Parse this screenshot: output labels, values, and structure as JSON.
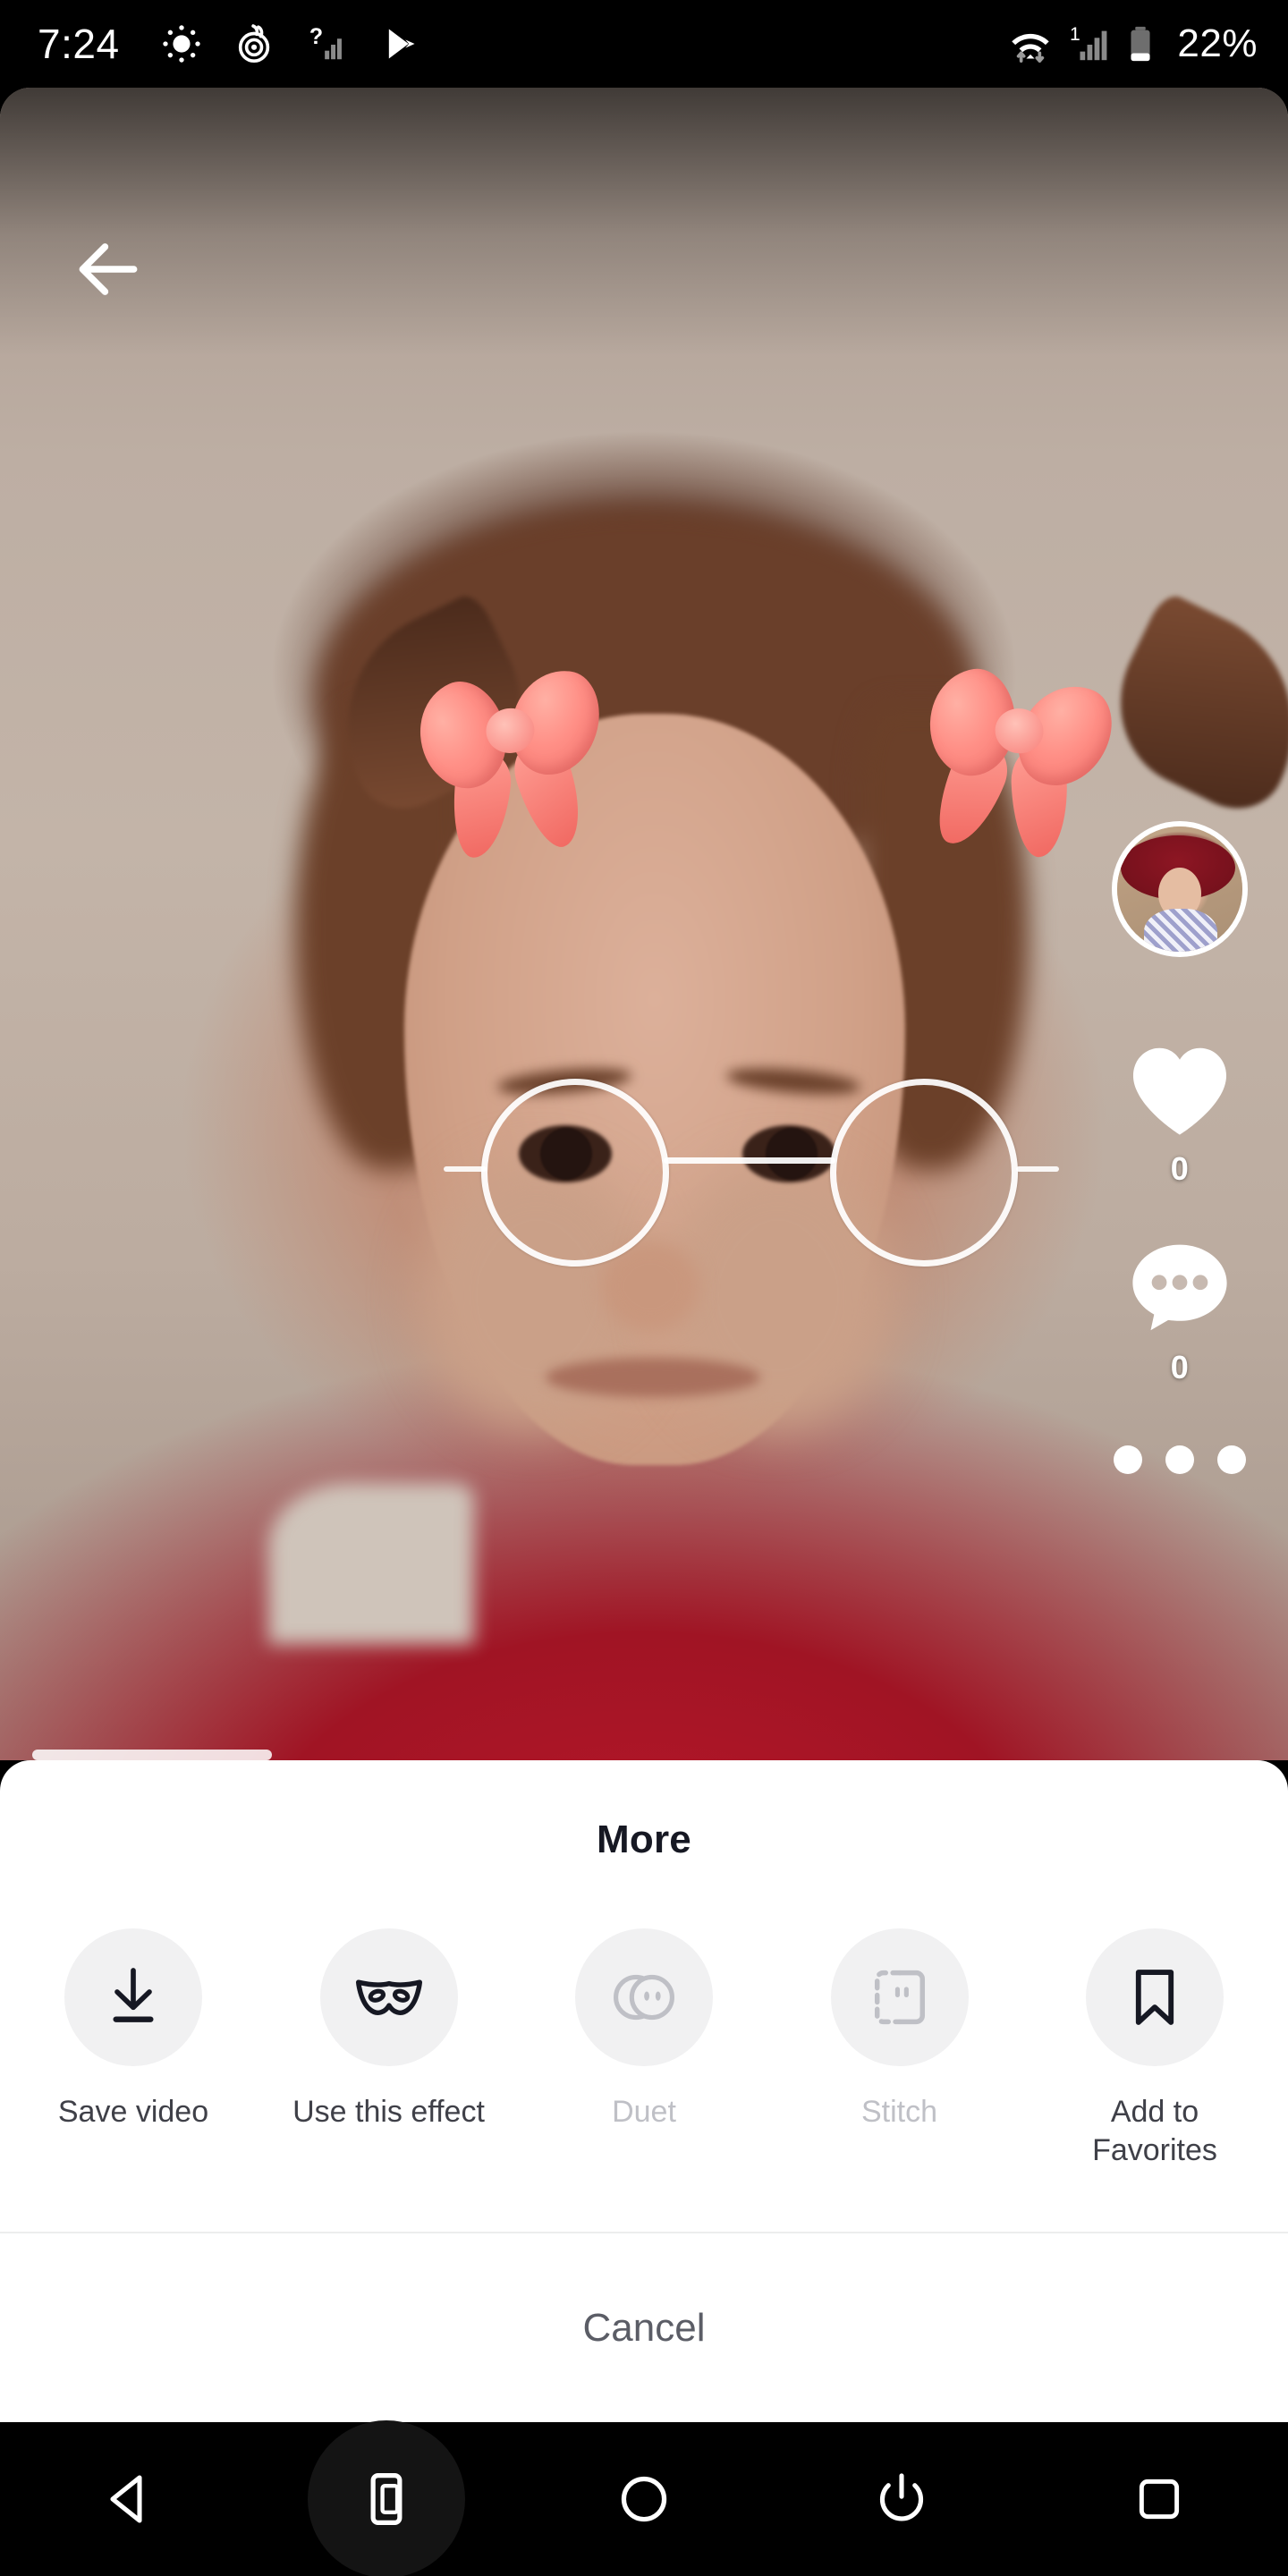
{
  "status_bar": {
    "time": "7:24",
    "battery_percent": "22%",
    "signal_label": "1",
    "icons": [
      "brightness-icon",
      "swirl-icon",
      "no-sim-signal-icon",
      "play-store-icon",
      "wifi-icon",
      "cellular-signal-icon",
      "battery-icon"
    ]
  },
  "video": {
    "back_icon": "back-arrow-icon",
    "description": "TikTok video with AR effect: woman with pink bows, round glasses and red turtleneck"
  },
  "action_rail": {
    "avatar_name": "creator-avatar",
    "like": {
      "icon": "heart-icon",
      "count": "0"
    },
    "comment": {
      "icon": "comment-bubble-icon",
      "count": "0"
    },
    "share": {
      "icon": "three-dots-icon"
    }
  },
  "sheet": {
    "title": "More",
    "actions": [
      {
        "label": "Save video",
        "icon": "download-icon",
        "disabled": false
      },
      {
        "label": "Use this effect",
        "icon": "mask-icon",
        "disabled": false
      },
      {
        "label": "Duet",
        "icon": "duet-icon",
        "disabled": true
      },
      {
        "label": "Stitch",
        "icon": "stitch-icon",
        "disabled": true
      },
      {
        "label": "Add to Favorites",
        "icon": "bookmark-icon",
        "disabled": false
      }
    ],
    "cancel_label": "Cancel"
  },
  "nav_bar": {
    "buttons": [
      {
        "name": "back-button",
        "icon": "triangle-back-icon"
      },
      {
        "name": "screenshot-button",
        "icon": "device-screenshot-icon"
      },
      {
        "name": "home-button",
        "icon": "circle-home-icon"
      },
      {
        "name": "power-button",
        "icon": "power-icon"
      },
      {
        "name": "recents-button",
        "icon": "square-recents-icon"
      }
    ]
  },
  "colors": {
    "sheet_bg": "#ffffff",
    "title_text": "#161823",
    "label_text": "#3f4048",
    "disabled_text": "#bfc0c6",
    "icon_bg": "#f1f1f2",
    "cancel_text": "#5b5d66",
    "nav_bg": "#000000"
  }
}
